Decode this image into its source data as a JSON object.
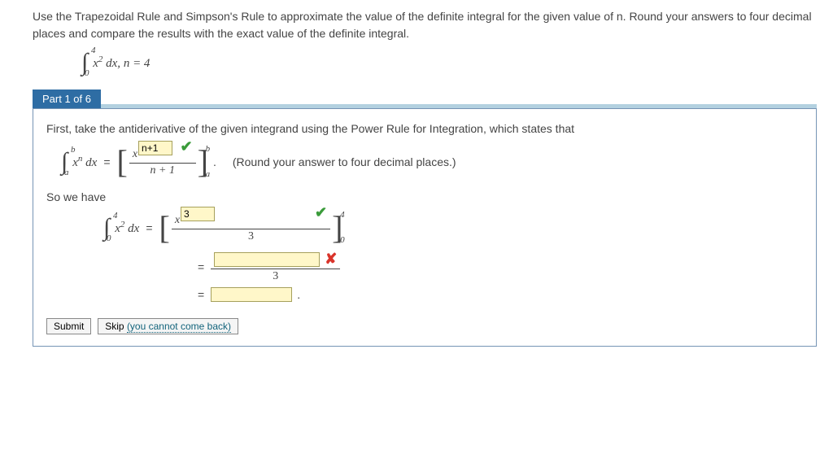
{
  "problem": {
    "instructions": "Use the Trapezoidal Rule and Simpson's Rule to approximate the value of the definite integral for the given value of n. Round your answers to four decimal places and compare the results with the exact value of the definite integral.",
    "integral_upper": "4",
    "integral_lower": "0",
    "integrand": "x",
    "integrand_power": "2",
    "dx": " dx,",
    "integrand_after": "  n = 4"
  },
  "part": {
    "label": "Part 1 of 6"
  },
  "step": {
    "intro": "First, take the antiderivative of the given integrand using the Power Rule for Integration, which states that",
    "rule": {
      "upper": "b",
      "lower": "a",
      "integrand_var": "x",
      "integrand_power": "n",
      "dx": " dx",
      "eq": " = ",
      "num_x": "x",
      "input_exp": "n+1",
      "den": "n + 1",
      "round_note": "(Round your answer to four decimal places.)"
    },
    "so_we_have": "So we have",
    "line1": {
      "upper": "4",
      "lower": "0",
      "integrand_var": "x",
      "integrand_power": "2",
      "dx": " dx",
      "eq": " = ",
      "num_x": "x",
      "input_exp": "3",
      "den": "3",
      "br_upper": "4",
      "br_lower": "0"
    },
    "line2": {
      "eq": " = ",
      "input_num": "",
      "den": "3"
    },
    "line3": {
      "eq": " = ",
      "input": ""
    }
  },
  "buttons": {
    "submit": "Submit",
    "skip_pre": "Skip ",
    "skip_note": "(you cannot come back)"
  }
}
